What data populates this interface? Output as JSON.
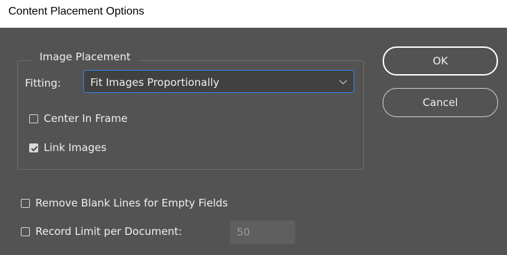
{
  "window": {
    "title": "Content Placement Options"
  },
  "image_placement": {
    "group_title": "Image Placement",
    "fitting_label": "Fitting:",
    "fitting_value": "Fit Images Proportionally",
    "center_in_frame": {
      "label": "Center In Frame",
      "checked": false
    },
    "link_images": {
      "label": "Link Images",
      "checked": true
    }
  },
  "options": {
    "remove_blank_lines": {
      "label": "Remove Blank Lines for Empty Fields",
      "checked": false
    },
    "record_limit": {
      "label": "Record Limit per Document:",
      "checked": false,
      "value": "50"
    }
  },
  "buttons": {
    "ok": "OK",
    "cancel": "Cancel"
  },
  "icons": {
    "dropdown": "chevron-down-icon",
    "check": "checkmark-icon"
  }
}
